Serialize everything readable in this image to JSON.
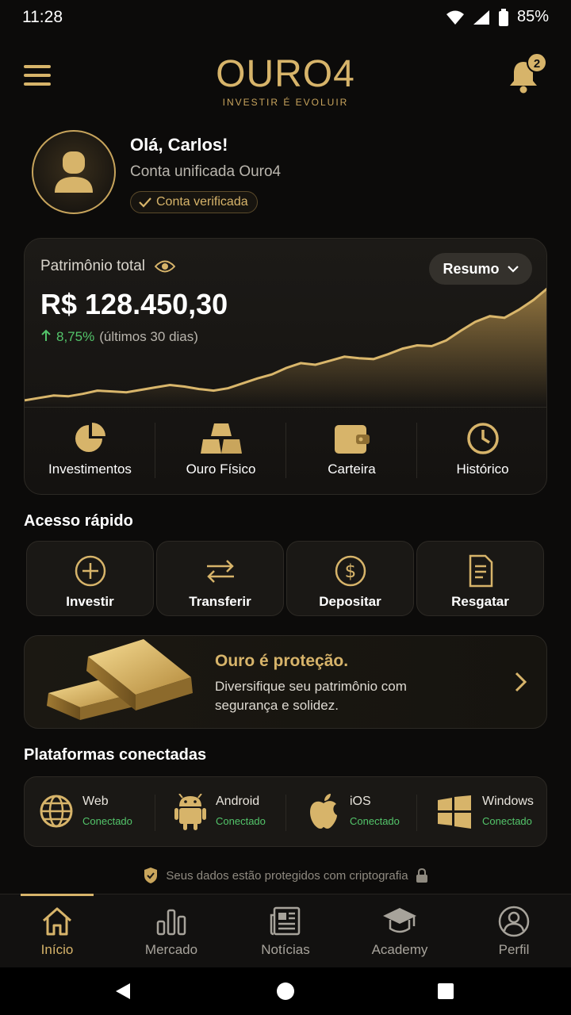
{
  "status_bar": {
    "time": "11:28",
    "battery": "85%"
  },
  "header": {
    "logo": "OURO4",
    "tagline": "INVESTIR É EVOLUIR",
    "notification_count": "2"
  },
  "profile": {
    "greeting": "Olá, Carlos!",
    "subtitle": "Conta unificada Ouro4",
    "verified_label": "Conta verificada"
  },
  "wealth": {
    "label": "Patrimônio total",
    "value": "R$ 128.450,30",
    "change_pct": "8,75%",
    "change_period": "(últimos 30 dias)",
    "filter_label": "Resumo",
    "trend": [
      6,
      9,
      12,
      11,
      14,
      18,
      17,
      16,
      19,
      22,
      25,
      23,
      20,
      18,
      21,
      27,
      33,
      38,
      46,
      52,
      50,
      55,
      60,
      58,
      57,
      63,
      70,
      74,
      73,
      80,
      92,
      103,
      110,
      108,
      118,
      130,
      145
    ]
  },
  "shortcuts": [
    {
      "label": "Investimentos",
      "icon": "pie-chart-icon"
    },
    {
      "label": "Ouro Físico",
      "icon": "gold-bars-icon"
    },
    {
      "label": "Carteira",
      "icon": "wallet-icon"
    },
    {
      "label": "Histórico",
      "icon": "clock-icon"
    }
  ],
  "quick_access": {
    "title": "Acesso rápido",
    "items": [
      {
        "label": "Investir",
        "icon": "plus-circle-icon"
      },
      {
        "label": "Transferir",
        "icon": "transfer-icon"
      },
      {
        "label": "Depositar",
        "icon": "dollar-circle-icon"
      },
      {
        "label": "Resgatar",
        "icon": "document-icon"
      }
    ]
  },
  "promo": {
    "title": "Ouro é proteção.",
    "text": "Diversifique seu patrimônio com segurança e solidez."
  },
  "platforms": {
    "title": "Plataformas conectadas",
    "items": [
      {
        "name": "Web",
        "status": "Conectado",
        "icon": "globe-icon"
      },
      {
        "name": "Android",
        "status": "Conectado",
        "icon": "android-icon"
      },
      {
        "name": "iOS",
        "status": "Conectado",
        "icon": "apple-icon"
      },
      {
        "name": "Windows",
        "status": "Conectado",
        "icon": "windows-icon"
      }
    ]
  },
  "security_note": "Seus dados estão protegidos com criptografia",
  "nav": {
    "items": [
      {
        "label": "Início",
        "icon": "home-icon",
        "active": true
      },
      {
        "label": "Mercado",
        "icon": "bar-chart-icon",
        "active": false
      },
      {
        "label": "Notícias",
        "icon": "newspaper-icon",
        "active": false
      },
      {
        "label": "Academy",
        "icon": "graduation-cap-icon",
        "active": false
      },
      {
        "label": "Perfil",
        "icon": "user-circle-icon",
        "active": false
      }
    ]
  },
  "colors": {
    "accent": "#d7b46a",
    "positive": "#53c46a",
    "background": "#0c0b0a"
  }
}
